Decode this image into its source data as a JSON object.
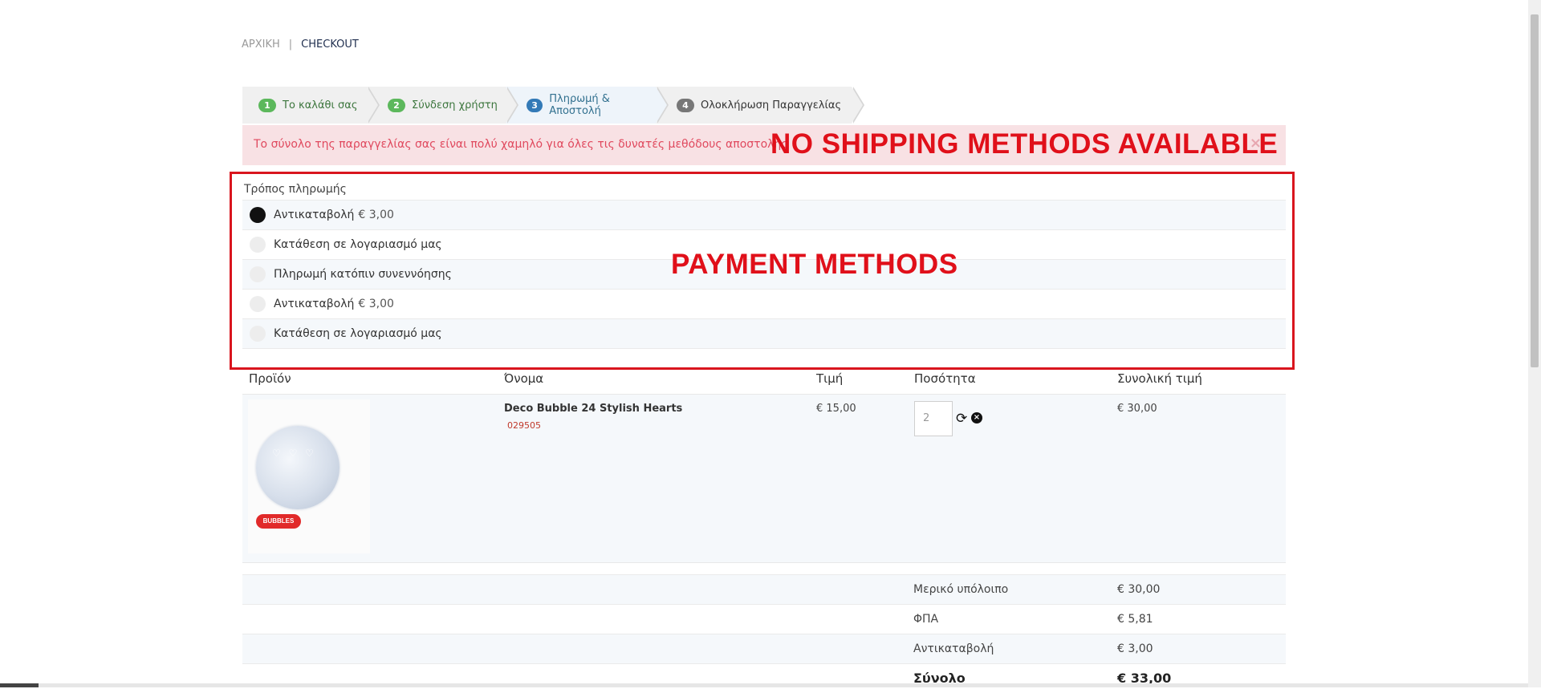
{
  "breadcrumb": {
    "home": "ΑΡΧΙΚΗ",
    "separator": "|",
    "current": "CHECKOUT"
  },
  "steps": [
    {
      "num": "1",
      "label": "Το καλάθι σας"
    },
    {
      "num": "2",
      "label": "Σύνδεση χρήστη"
    },
    {
      "num": "3",
      "label": "Πληρωμή & Αποστολή"
    },
    {
      "num": "4",
      "label": "Ολοκλήρωση Παραγγελίας"
    }
  ],
  "alert": {
    "message": "Το σύνολο της παραγγελίας σας είναι πολύ χαμηλό για όλες τις δυνατές μεθόδους αποστολής",
    "close": "×"
  },
  "annotations": {
    "shipping": "NO SHIPPING METHODS AVAILABLE",
    "payment": "PAYMENT METHODS"
  },
  "payment": {
    "title": "Τρόπος πληρωμής",
    "methods": [
      {
        "label": "Αντικαταβολή",
        "price": "€ 3,00",
        "selected": true
      },
      {
        "label": "Κατάθεση σε λογαριασμό μας",
        "price": "",
        "selected": false
      },
      {
        "label": "Πληρωμή κατόπιν συνεννόησης",
        "price": "",
        "selected": false
      },
      {
        "label": "Αντικαταβολή",
        "price": "€ 3,00",
        "selected": false
      },
      {
        "label": "Κατάθεση σε λογαριασμό μας",
        "price": "",
        "selected": false
      }
    ]
  },
  "cart": {
    "headers": {
      "product": "Προϊόν",
      "name": "Όνομα",
      "price": "Τιμή",
      "quantity": "Ποσότητα",
      "total": "Συνολική τιμή"
    },
    "item": {
      "name": "Deco Bubble 24 Stylish Hearts",
      "sku": "029505",
      "price": "€ 15,00",
      "quantity": "2",
      "total": "€ 30,00",
      "badge": "BUBBLES"
    }
  },
  "summary": [
    {
      "label": "Μερικό υπόλοιπο",
      "value": "€ 30,00"
    },
    {
      "label": "ΦΠΑ",
      "value": "€ 5,81"
    },
    {
      "label": "Αντικαταβολή",
      "value": "€ 3,00"
    },
    {
      "label": "Σύνολο",
      "value": "€ 33,00"
    }
  ],
  "colors": {
    "annotation": "#e0101a",
    "alert_bg": "#f8e1e4",
    "alert_text": "#e0495e",
    "step_green": "#5cb85c",
    "step_blue": "#337ab7",
    "step_gray": "#777777"
  },
  "icons": {
    "refresh": "refresh-icon",
    "remove": "remove-icon",
    "close": "close-icon"
  }
}
